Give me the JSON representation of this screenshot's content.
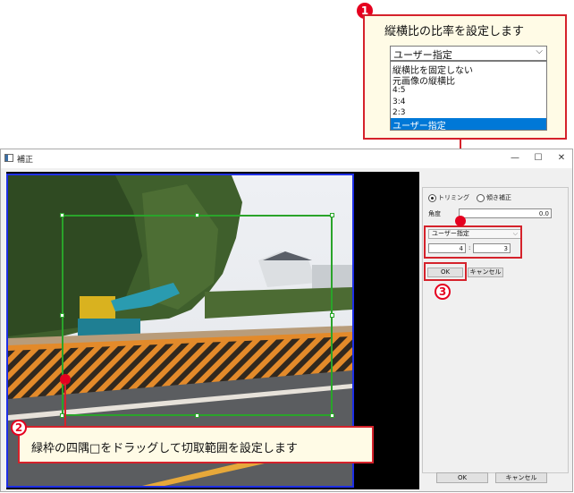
{
  "window": {
    "title": "補正",
    "minimize_glyph": "—",
    "maximize_glyph": "☐",
    "close_glyph": "✕"
  },
  "panel": {
    "mode_trim": "トリミング",
    "mode_skew": "傾き補正",
    "angle_label": "角度",
    "angle_value": "0.0",
    "ratio_select_value": "ユーザー指定",
    "ratio_width": "4",
    "ratio_separator": ":",
    "ratio_height": "3",
    "ok_label": "OK",
    "cancel_label": "キャンセル"
  },
  "footer": {
    "ok_label": "OK",
    "cancel_label": "キャンセル"
  },
  "callouts": {
    "one": {
      "number": "1",
      "text": "縦横比の比率を設定します",
      "dropdown_value": "ユーザー指定",
      "options": [
        "縦横比を固定しない",
        "元画像の縦横比",
        "4:5",
        "3:4",
        "2:3",
        "ユーザー指定"
      ],
      "selected_index": 5
    },
    "two": {
      "number": "2",
      "text": "緑枠の四隅□をドラッグして切取範囲を設定します"
    },
    "three": {
      "number": "3"
    }
  },
  "colors": {
    "callout_border": "#d5222b",
    "crop_frame": "#2aa42a",
    "image_border": "#1e2fe6",
    "selected_option": "#0078d7"
  }
}
